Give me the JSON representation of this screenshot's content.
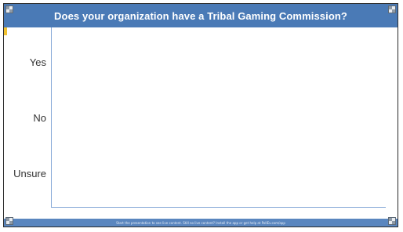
{
  "poll": {
    "title": "Does your organization have a Tribal Gaming Commission?",
    "options": [
      {
        "label": "Yes"
      },
      {
        "label": "No"
      },
      {
        "label": "Unsure"
      }
    ],
    "footer": "Start the presentation to see live content. Still no live content? Install the app or get help at PollEv.com/app"
  },
  "colors": {
    "title_bar": "#4a7ab6",
    "axis": "#87a9d8",
    "footer_bar": "#5a86bf",
    "accent": "#f2c230"
  }
}
